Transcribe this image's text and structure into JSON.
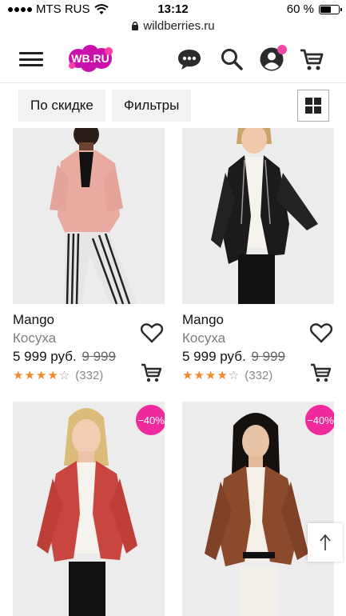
{
  "status_bar": {
    "carrier": "MTS RUS",
    "time": "13:12",
    "battery": "60 %",
    "battery_level": 0.6
  },
  "browser": {
    "url": "wildberries.ru"
  },
  "header": {
    "logo": "WB.RU"
  },
  "toolbar": {
    "sort_label": "По скидке",
    "filters_label": "Фильтры"
  },
  "products": [
    {
      "brand": "Mango",
      "name": "Косуха",
      "price": "5 999 руб.",
      "old_price": "9 999",
      "rating": 4,
      "reviews": "(332)",
      "discount": "",
      "jacket_color": "#e9aaa2"
    },
    {
      "brand": "Mango",
      "name": "Косуха",
      "price": "5 999 руб.",
      "old_price": "9 999",
      "rating": 4,
      "reviews": "(332)",
      "discount": "",
      "jacket_color": "#1b1b1b"
    },
    {
      "brand": "",
      "name": "",
      "price": "",
      "old_price": "",
      "rating": 0,
      "reviews": "",
      "discount": "−40%",
      "jacket_color": "#c8463f"
    },
    {
      "brand": "",
      "name": "",
      "price": "",
      "old_price": "",
      "rating": 0,
      "reviews": "",
      "discount": "−40%",
      "jacket_color": "#8b4a2b"
    }
  ],
  "colors": {
    "accent": "#f02a9c",
    "star": "#f5892a"
  }
}
